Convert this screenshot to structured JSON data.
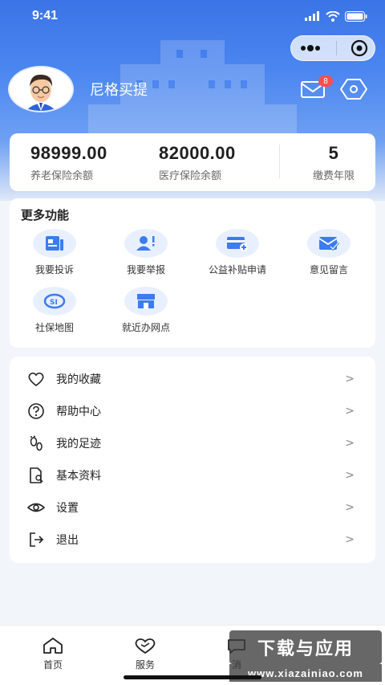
{
  "status_bar": {
    "time": "9:41"
  },
  "header": {
    "username": "尼格买提",
    "mail_badge": "8"
  },
  "stats": [
    {
      "value": "98999.00",
      "label": "养老保险余额"
    },
    {
      "value": "82000.00",
      "label": "医疗保险余额"
    },
    {
      "value": "5",
      "label": "缴费年限"
    }
  ],
  "functions": {
    "title": "更多功能",
    "items": [
      {
        "label": "我要投诉",
        "icon": "complaint-icon"
      },
      {
        "label": "我要举报",
        "icon": "report-icon"
      },
      {
        "label": "公益补贴申请",
        "icon": "subsidy-card-icon"
      },
      {
        "label": "意见留言",
        "icon": "feedback-mail-icon"
      },
      {
        "label": "社保地图",
        "icon": "si-map-icon"
      },
      {
        "label": "就近办网点",
        "icon": "store-icon"
      }
    ]
  },
  "menu": [
    {
      "label": "我的收藏",
      "icon": "heart-icon"
    },
    {
      "label": "帮助中心",
      "icon": "help-icon"
    },
    {
      "label": "我的足迹",
      "icon": "footprint-icon"
    },
    {
      "label": "基本资料",
      "icon": "profile-doc-icon"
    },
    {
      "label": "设置",
      "icon": "settings-eye-icon"
    },
    {
      "label": "退出",
      "icon": "logout-icon"
    }
  ],
  "menu_arrow": ">",
  "tabbar": [
    {
      "label": "首页",
      "icon": "home-icon"
    },
    {
      "label": "服务",
      "icon": "service-heart-icon"
    },
    {
      "label": "消",
      "icon": "message-icon"
    }
  ],
  "watermark": {
    "title": "下载与应用",
    "url": "www.xiazainiao.com"
  },
  "colors": {
    "primary": "#3b74e6",
    "badge": "#ff4d4f",
    "icon_bg": "#e8f0ff",
    "icon_blue": "#3d7bf0"
  }
}
